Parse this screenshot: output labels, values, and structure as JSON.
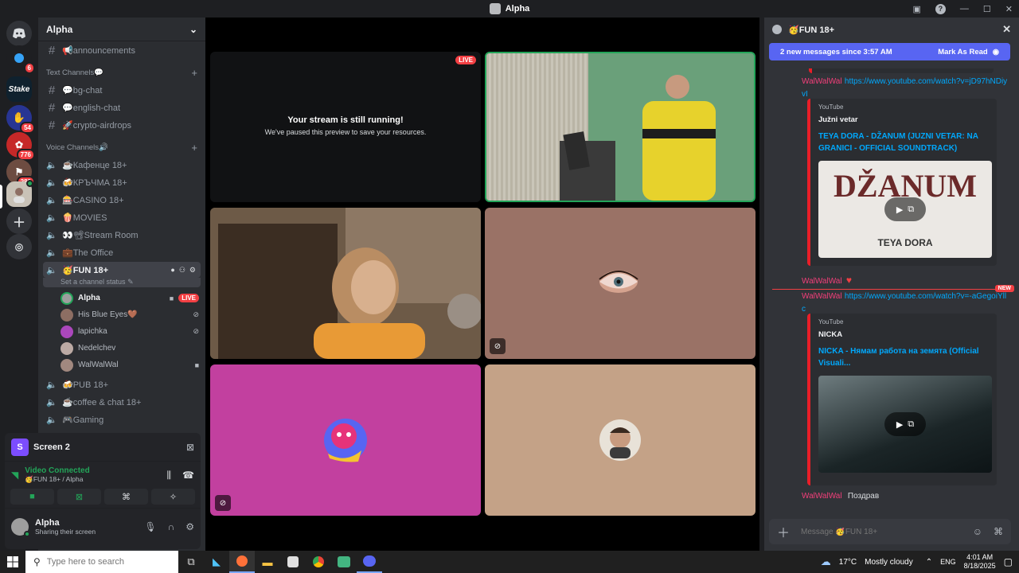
{
  "window": {
    "title": "Alpha"
  },
  "servers": [
    {
      "name": "discord-home"
    },
    {
      "name": "server-1",
      "badge": "6"
    },
    {
      "name": "stake",
      "label": "Stake"
    },
    {
      "name": "server-3",
      "badge": "54"
    },
    {
      "name": "server-4",
      "badge": "776"
    },
    {
      "name": "server-5",
      "badge": "282"
    },
    {
      "name": "alpha-server"
    }
  ],
  "guild": {
    "name": "Alpha"
  },
  "channels": {
    "announcements": "📢announcements",
    "text_category": "Text Channels💬",
    "text": [
      "💬bg-chat",
      "💬english-chat",
      "🚀crypto-airdrops"
    ],
    "voice_category": "Voice Channels🔊",
    "voice": [
      "☕Кафенце 18+",
      "🍻КРЪЧМА 18+",
      "🎰CASINO 18+",
      "🍿MOVIES",
      "👀📽Stream Room",
      "💼The Office"
    ],
    "active": "🥳FUN 18+",
    "active_status": "Set a channel status",
    "after": [
      "🍻PUB 18+",
      "☕coffee & chat 18+",
      "🎮Gaming"
    ]
  },
  "voice_users": [
    {
      "name": "Alpha",
      "live": "LIVE"
    },
    {
      "name": "His Blue Eyes🤎"
    },
    {
      "name": "lapichka"
    },
    {
      "name": "Nedelchev"
    },
    {
      "name": "WalWalWal"
    }
  ],
  "screen_panel": {
    "initial": "S",
    "title": "Screen 2"
  },
  "connection": {
    "status": "Video Connected",
    "location": "🥳FUN 18+ / Alpha"
  },
  "user": {
    "name": "Alpha",
    "status": "Sharing their screen"
  },
  "stage": {
    "paused_title": "Your stream is still running!",
    "paused_sub": "We've paused this preview to save your resources.",
    "live": "LIVE"
  },
  "chat": {
    "channel": "🥳FUN 18+",
    "new_messages": "2 new messages since 3:57 AM",
    "mark_read": "Mark As Read",
    "new_badge": "NEW",
    "messages": [
      {
        "user": "WalWalWal",
        "link": "https://www.youtube.com/watch?v=jD97hNDiyvI"
      },
      {
        "user": "WalWalWal",
        "link": "https://www.youtube.com/watch?v=-aGegoiYllc"
      },
      {
        "user": "WalWalWal",
        "text": "Поздрав"
      }
    ],
    "embeds": [
      {
        "provider": "YouTube",
        "author": "Južni vetar",
        "title": "TEYA DORA - DŽANUM (JUZNI VETAR: NA GRANICI - OFFICIAL SOUNDTRACK)",
        "thumb_big": "DŽANUM",
        "thumb_small": "TEYA DORA"
      },
      {
        "provider": "YouTube",
        "author": "NICKA",
        "title": "NICKA - Нямам работа на земята (Official Visuali..."
      }
    ],
    "input_placeholder": "Message 🥳FUN 18+"
  },
  "taskbar": {
    "search_placeholder": "Type here to search",
    "weather": "17°C",
    "weather_desc": "Mostly cloudy",
    "lang": "ENG",
    "time": "4:01 AM",
    "date": "8/18/2025"
  }
}
